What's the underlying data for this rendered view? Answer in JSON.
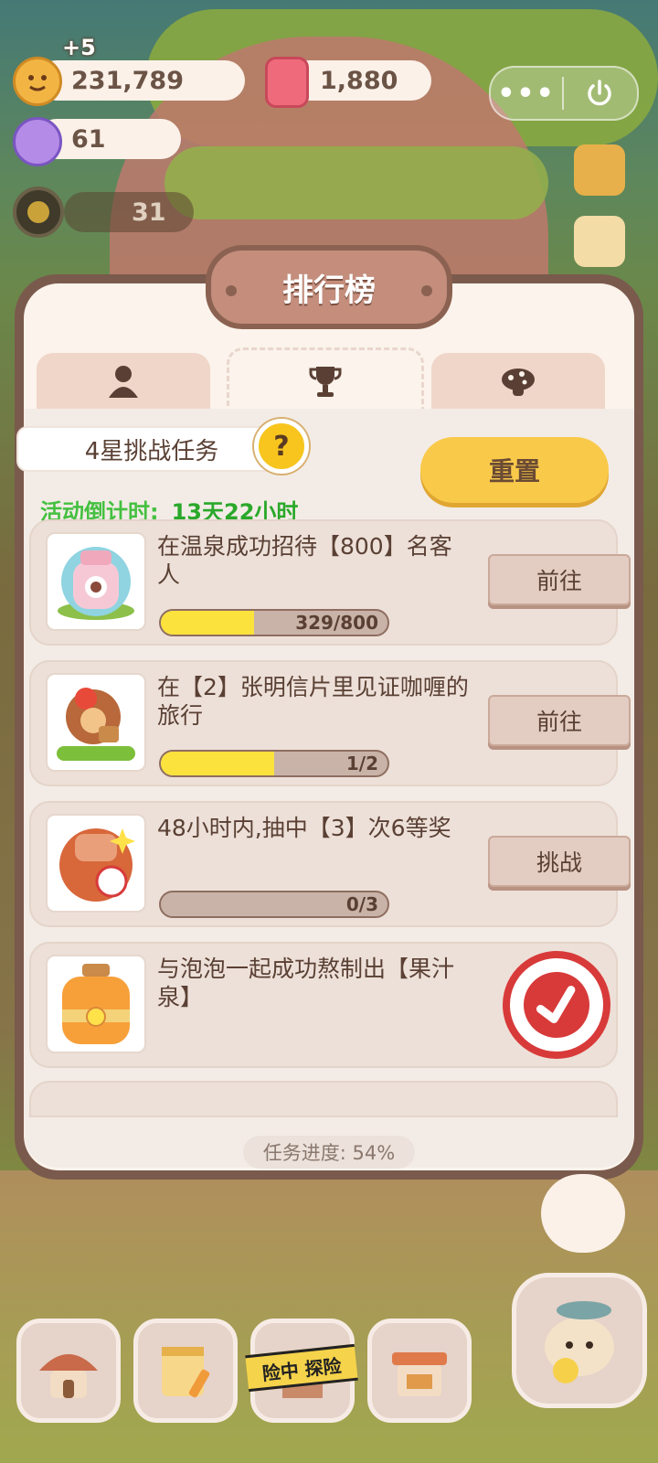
{
  "resources": {
    "cookie_gain": "+5",
    "coins": "231,789",
    "crystals": "1,880",
    "candies": "61",
    "level_count": "31"
  },
  "panel": {
    "title": "排行榜",
    "task_title": "4星挑战任务",
    "help_symbol": "?",
    "countdown_label": "活动倒计时:",
    "countdown_value": "13天22小时",
    "reset_label": "重置",
    "footer_progress": "任务进度: 54%"
  },
  "tasks": [
    {
      "desc": "在温泉成功招待【800】名客人",
      "progress_text": "329/800",
      "progress_fraction": 0.41,
      "action": "前往"
    },
    {
      "desc": "在【2】张明信片里见证咖喱的旅行",
      "progress_text": "1/2",
      "progress_fraction": 0.5,
      "action": "前往"
    },
    {
      "desc": "48小时内,抽中【3】次6等奖",
      "progress_text": "0/3",
      "progress_fraction": 0,
      "action": "挑战"
    },
    {
      "desc": "与泡泡一起成功熬制出【果汁泉】",
      "completed": true
    }
  ],
  "bottom_nav": {
    "tape_text": "险中 探险"
  },
  "colors": {
    "accent_yellow": "#f9c94a",
    "progress_fill": "#fbe23d",
    "countdown_green": "#2aa82a",
    "stamp_red": "#d83a3a",
    "panel_border": "#7a5a4c"
  }
}
